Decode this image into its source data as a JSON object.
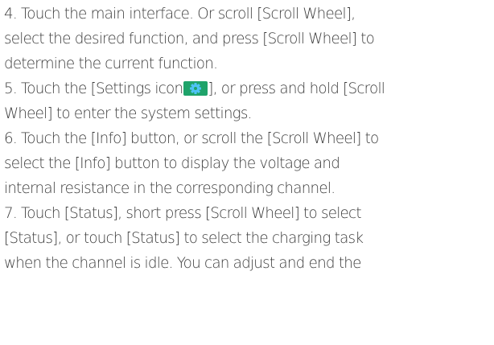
{
  "document": {
    "lines": [
      "4. Touch the main interface. Or scroll [Scroll Wheel],",
      "select the desired function, and press [Scroll Wheel] to",
      "determine the current function.",
      "5. Touch the [Settings icon",
      "], or press and hold [Scroll",
      "Wheel] to enter the system settings.",
      "6. Touch the [Info] button, or scroll the [Scroll Wheel] to",
      "select the [Info] button to display the voltage and",
      "internal resistance in the corresponding channel.",
      "7. Touch [Status], short press [Scroll Wheel] to select",
      "[Status], or touch [Status] to select the charging task",
      "when the channel is idle. You can adjust and end the"
    ],
    "settings_icon": {
      "icon": "gear-icon",
      "background_color": "#1fa36a",
      "gear_color": "#4fc3f7"
    }
  }
}
